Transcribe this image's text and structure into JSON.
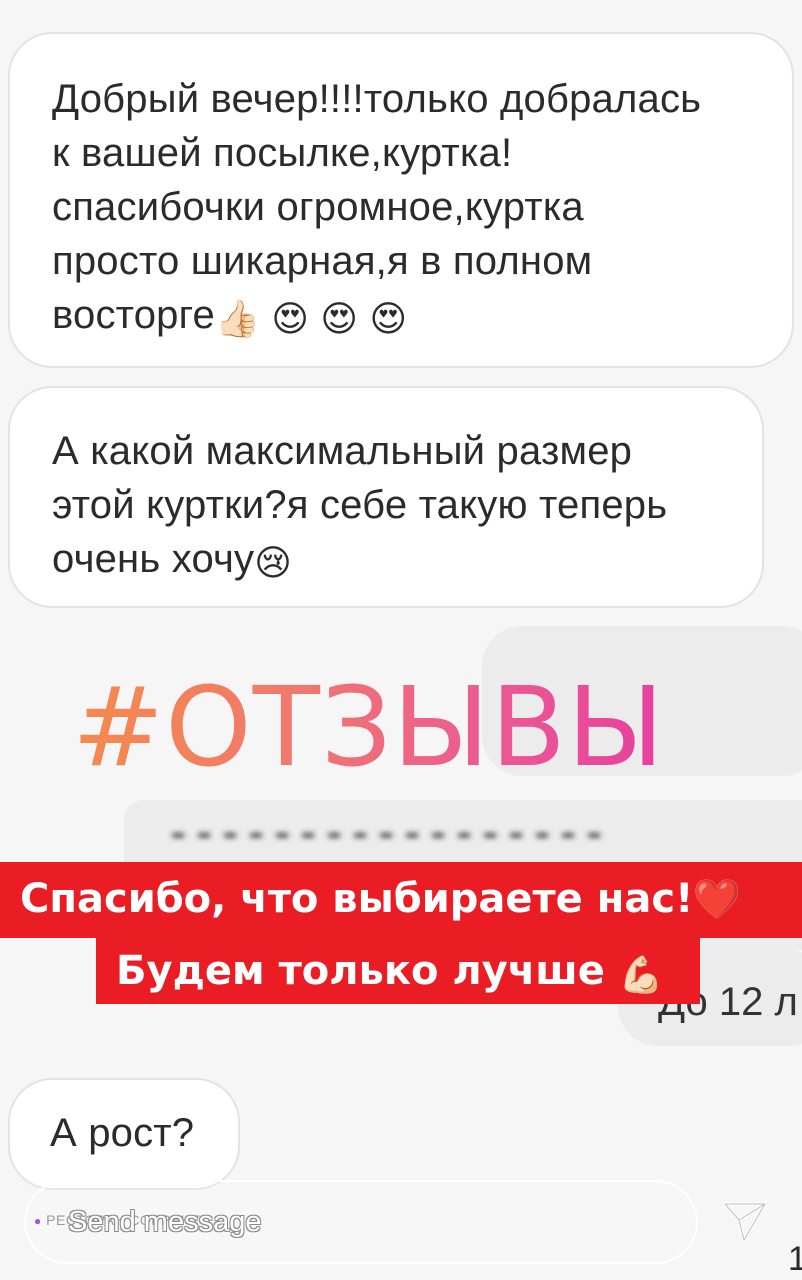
{
  "messages": [
    {
      "lines": [
        "Добрый вечер!!!!только добралась",
        "к вашей посылке,куртка!",
        "спасибочки огромное,куртка",
        "просто шикарная,я в полном"
      ],
      "last_line": "восторге",
      "emojis": [
        "👍🏻",
        "😍",
        "😍",
        "😍"
      ]
    },
    {
      "lines": [
        "А какой максимальный размер",
        "этой куртки?я себе такую теперь"
      ],
      "last_line": "очень хочу",
      "emojis": [
        "😢"
      ]
    },
    {
      "text": "А рост?"
    }
  ],
  "outgoing": {
    "partial_text": "До 12 л"
  },
  "overlay": {
    "hashtag": "#ОТЗЫВЫ",
    "banner_line1": "Спасибо, что выбираете нас!",
    "banner_line1_emoji": "❤️",
    "banner_line2": "Будем только лучше",
    "banner_line2_emoji": "💪🏻"
  },
  "composer": {
    "location_label": "РЕСТОРАН СОРРЕНТО",
    "placeholder": "Send message",
    "send_icon": "paper-plane-icon"
  },
  "corner_digit": "1",
  "colors": {
    "banner_red": "#ea1c24",
    "hashtag_gradient_start": "#f58a4c",
    "hashtag_gradient_end": "#e63f9f",
    "bubble_bg": "#ffffff",
    "outgoing_bubble_bg": "#ececec"
  }
}
